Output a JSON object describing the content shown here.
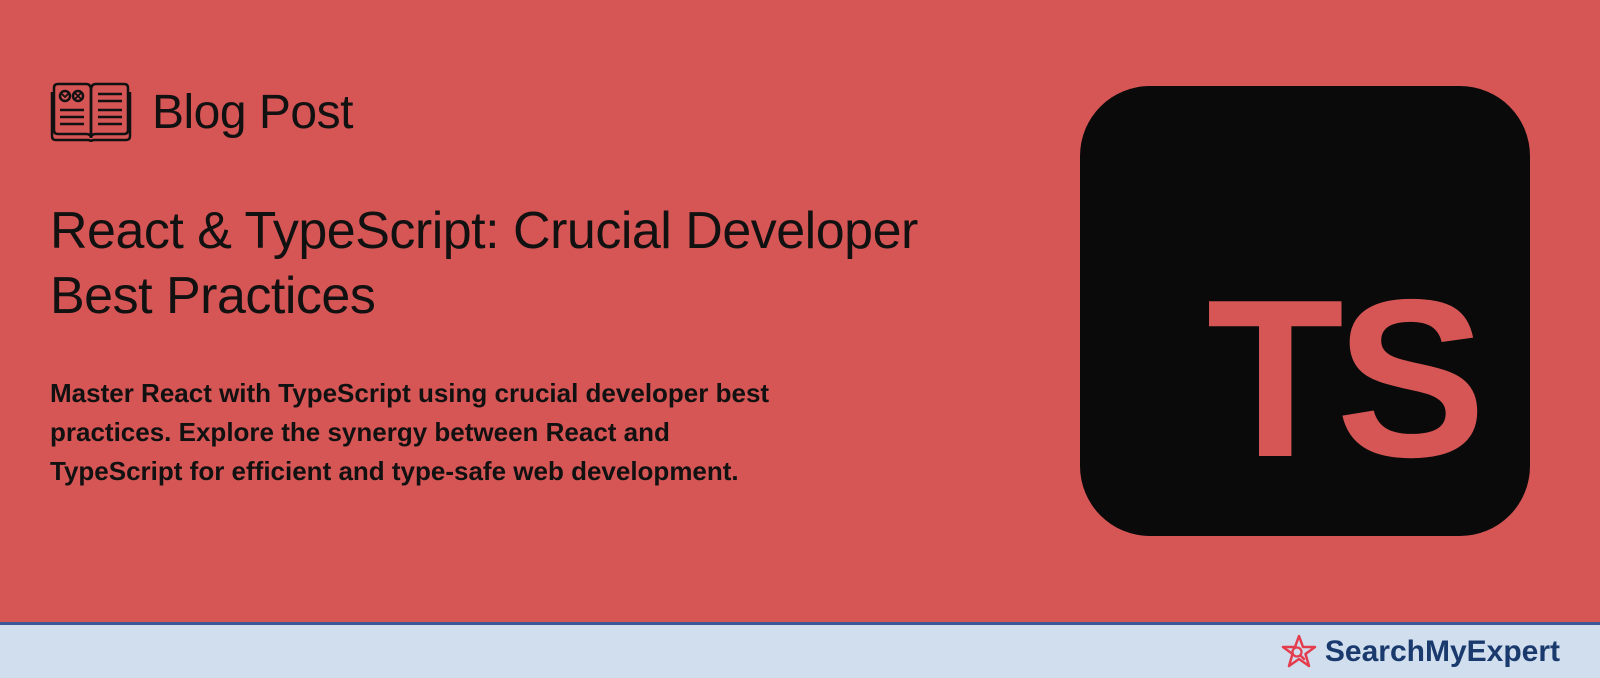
{
  "category": {
    "label": "Blog Post"
  },
  "article": {
    "headline": "React & TypeScript: Crucial Developer Best Practices",
    "description": "Master React with TypeScript using crucial developer best practices. Explore the synergy between React and TypeScript for efficient and type-safe web development."
  },
  "logo": {
    "ts_label": "TS"
  },
  "brand": {
    "name": "SearchMyExpert"
  }
}
